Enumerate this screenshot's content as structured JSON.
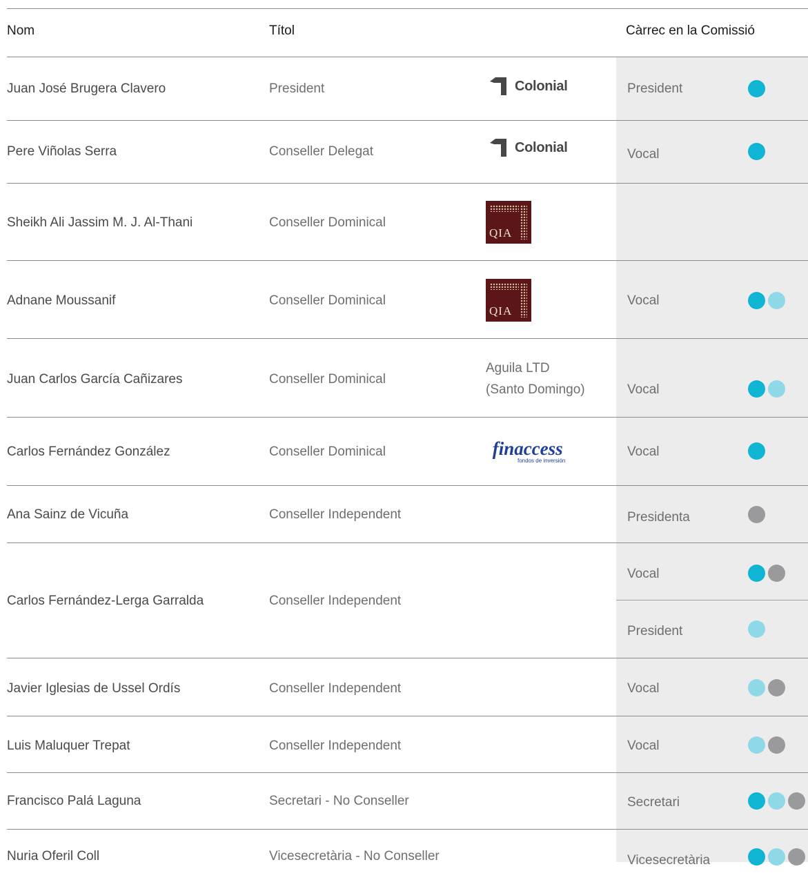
{
  "header": {
    "name": "Nom",
    "title": "Títol",
    "role": "Càrrec en la Comissió"
  },
  "colors": {
    "teal": "#0fb5d3",
    "light_blue": "#8ed8e8",
    "grey": "#9a9a9c"
  },
  "rows": [
    {
      "name": "Juan José Brugera Clavero",
      "title": "President",
      "org_logo": "Colonial",
      "role": "President",
      "dots": [
        "teal"
      ]
    },
    {
      "name": "Pere Viñolas Serra",
      "title": "Conseller Delegat",
      "org_logo": "Colonial",
      "role": "Vocal",
      "dots": [
        "teal"
      ]
    },
    {
      "name": "Sheikh Ali Jassim M. J. Al-Thani",
      "title": "Conseller Dominical",
      "org_logo": "QIA",
      "role": "",
      "dots": []
    },
    {
      "name": "Adnane Moussanif",
      "title": "Conseller Dominical",
      "org_logo": "QIA",
      "role": "Vocal",
      "dots": [
        "teal",
        "light_blue"
      ]
    },
    {
      "name": "Juan Carlos García Cañizares",
      "title": "Conseller Dominical",
      "org_line1": "Aguila LTD",
      "org_line2": "(Santo Domingo)",
      "role": "Vocal",
      "dots": [
        "teal",
        "light_blue"
      ]
    },
    {
      "name": "Carlos Fernández González",
      "title": "Conseller Dominical",
      "org_logo": "finaccess",
      "org_logo_sub": "fondos de inversión",
      "role": "Vocal",
      "dots": [
        "teal"
      ]
    },
    {
      "name": "Ana Sainz de Vicuña",
      "title": "Conseller Independent",
      "role": "Presidenta",
      "dots": [
        "grey"
      ]
    },
    {
      "name": "Carlos Fernández-Lerga Garralda",
      "title": "Conseller Independent",
      "roles": [
        {
          "role": "Vocal",
          "dots": [
            "teal",
            "grey"
          ]
        },
        {
          "role": "President",
          "dots": [
            "light_blue"
          ]
        }
      ]
    },
    {
      "name": "Javier Iglesias de Ussel Ordís",
      "title": "Conseller Independent",
      "role": "Vocal",
      "dots": [
        "light_blue",
        "grey"
      ]
    },
    {
      "name": "Luis Maluquer Trepat",
      "title": "Conseller Independent",
      "role": "Vocal",
      "dots": [
        "light_blue",
        "grey"
      ]
    },
    {
      "name": "Francisco Palá Laguna",
      "title": "Secretari - No Conseller",
      "role": "Secretari",
      "dots": [
        "teal",
        "light_blue",
        "grey"
      ]
    },
    {
      "name": "Nuria Oferil Coll",
      "title": "Vicesecretària - No Conseller",
      "role": "Vicesecretària",
      "dots": [
        "teal",
        "light_blue",
        "grey"
      ]
    }
  ]
}
